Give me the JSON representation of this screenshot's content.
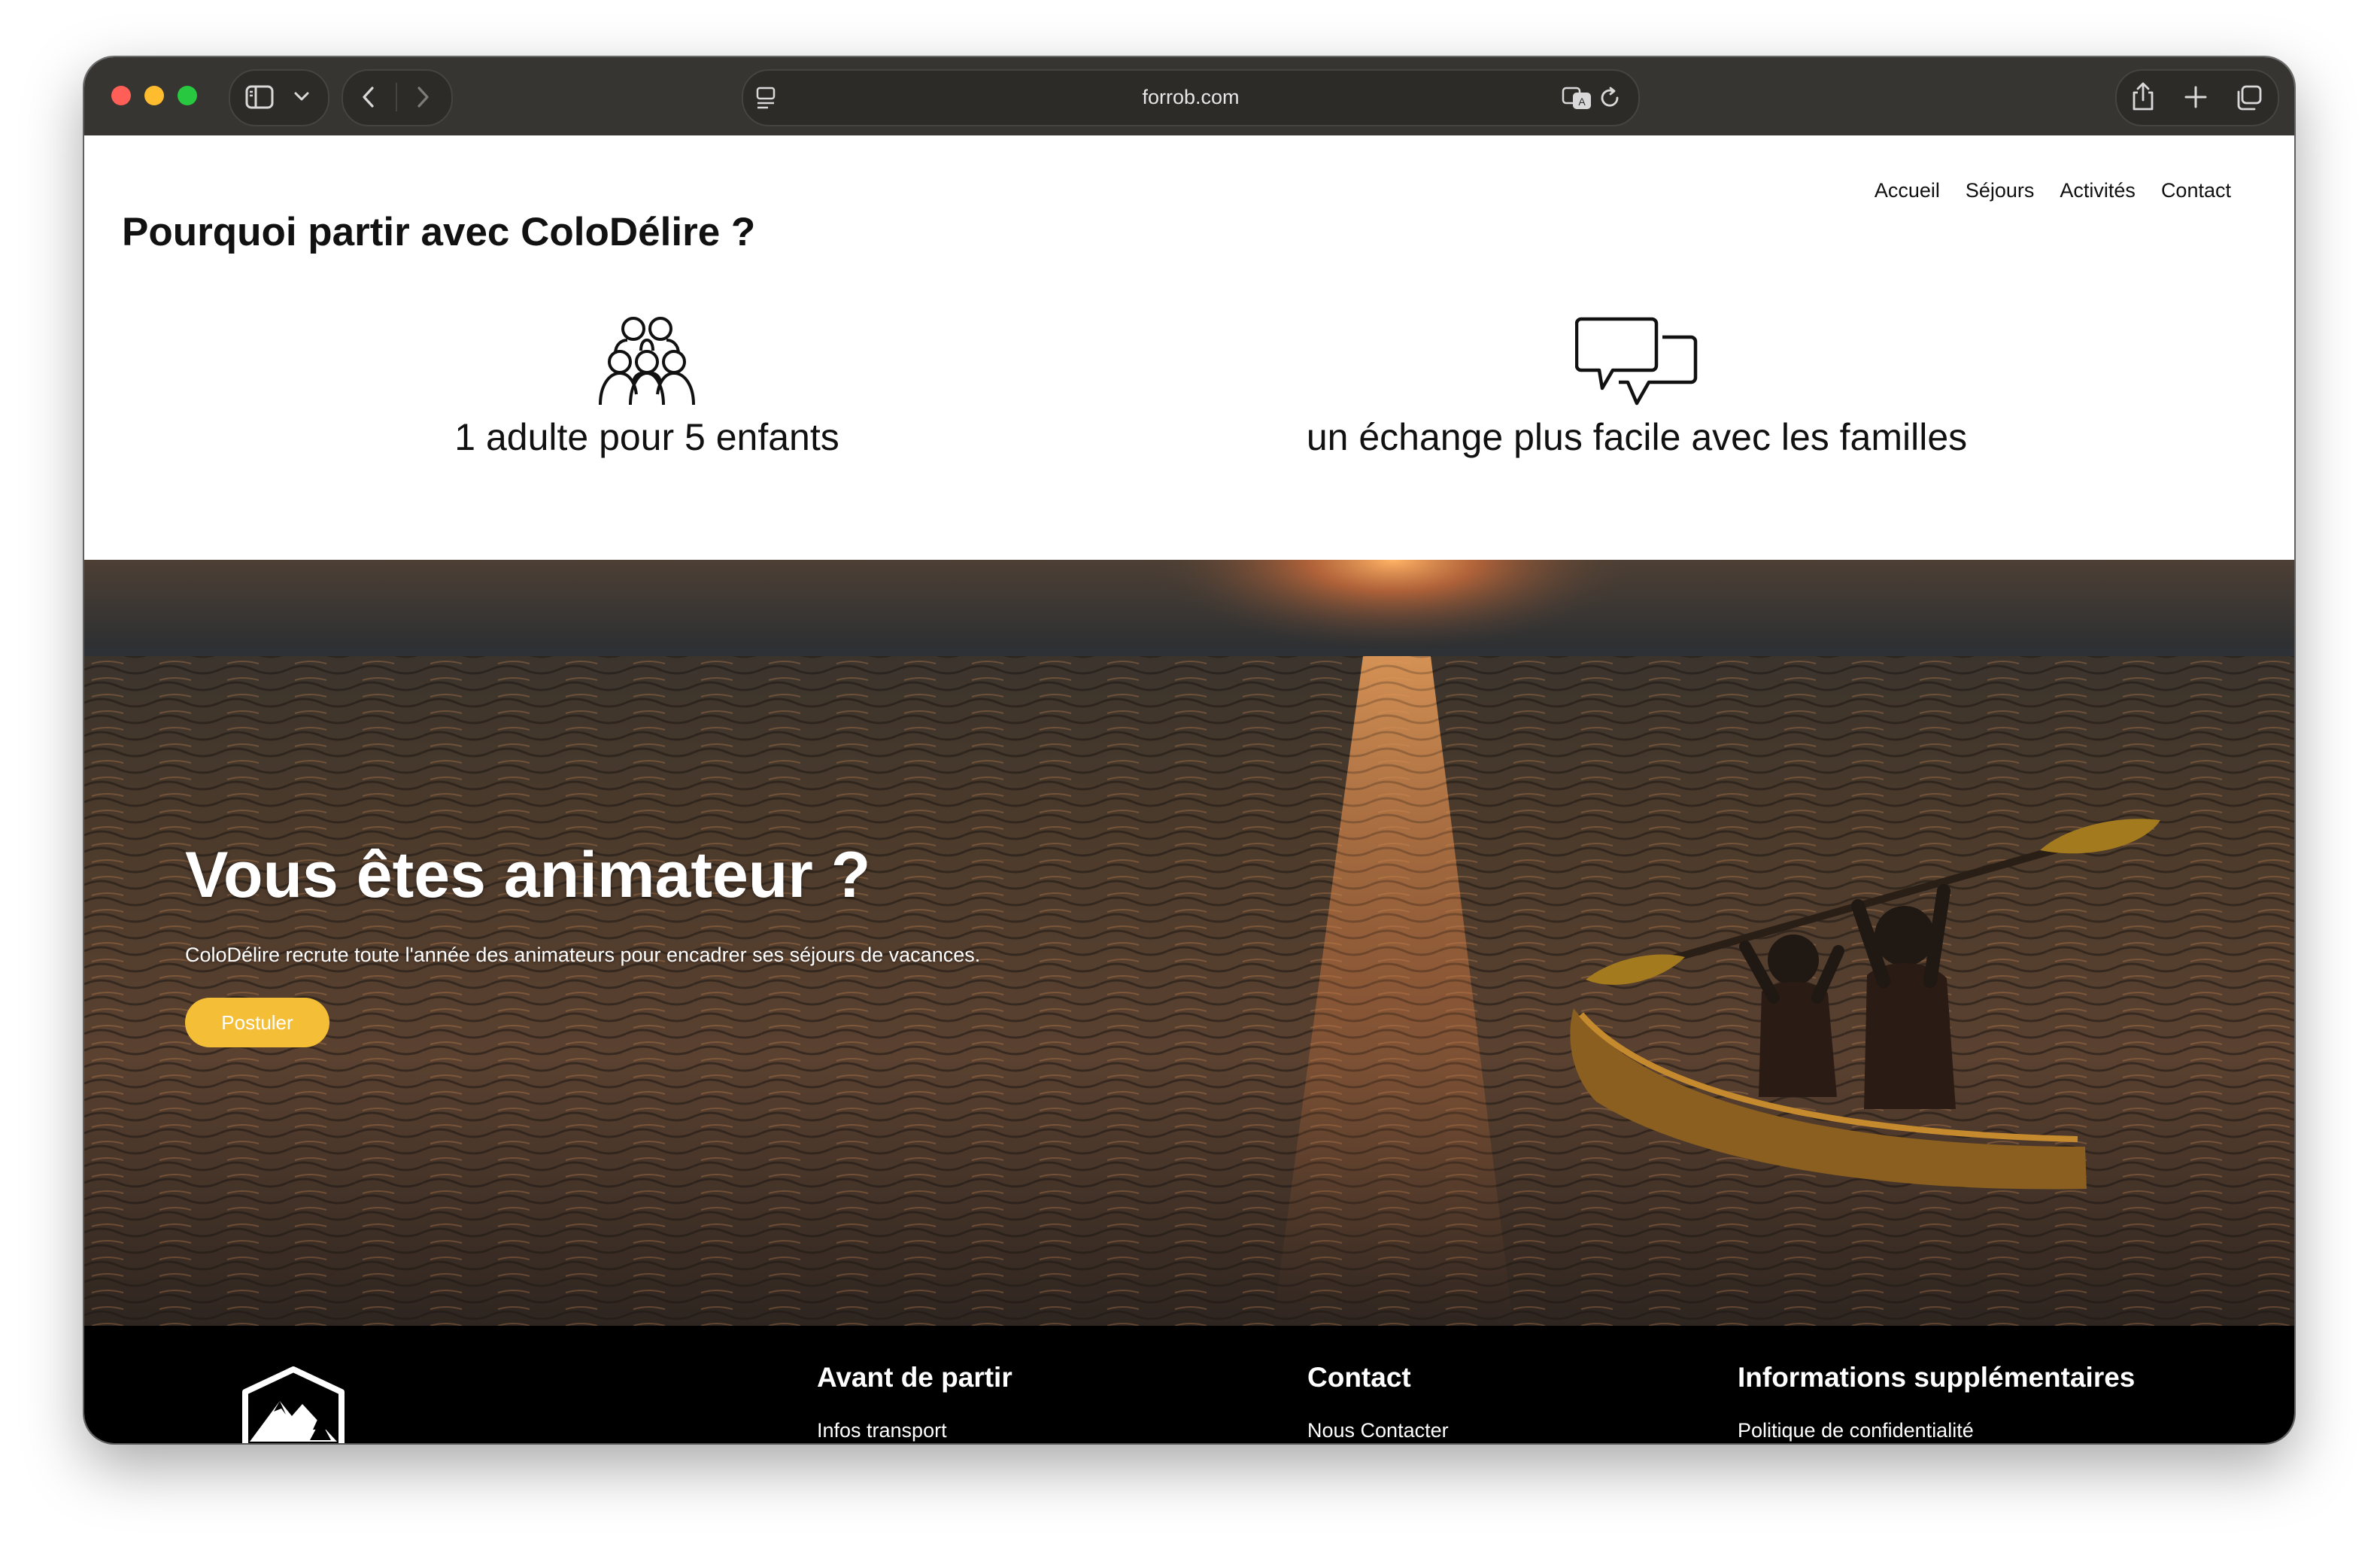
{
  "browser": {
    "url": "forrob.com"
  },
  "nav": {
    "items": [
      "Accueil",
      "Séjours",
      "Activités",
      "Contact"
    ]
  },
  "why": {
    "title": "Pourquoi partir avec ColoDélire ?",
    "features": [
      {
        "icon": "group-icon",
        "text": "1 adulte pour 5 enfants"
      },
      {
        "icon": "chat-bubbles-icon",
        "text": "un échange plus facile avec les familles"
      }
    ]
  },
  "hero": {
    "title": "Vous êtes animateur ?",
    "description": "ColoDélire recrute toute l'année des animateurs pour encadrer ses séjours de vacances.",
    "button_label": "Postuler",
    "button_color": "#f4bf36"
  },
  "footer": {
    "columns": [
      {
        "title": "Avant de partir",
        "link": "Infos transport"
      },
      {
        "title": "Contact",
        "link": "Nous Contacter"
      },
      {
        "title": "Informations supplémentaires",
        "link": "Politique de confidentialité"
      }
    ]
  }
}
